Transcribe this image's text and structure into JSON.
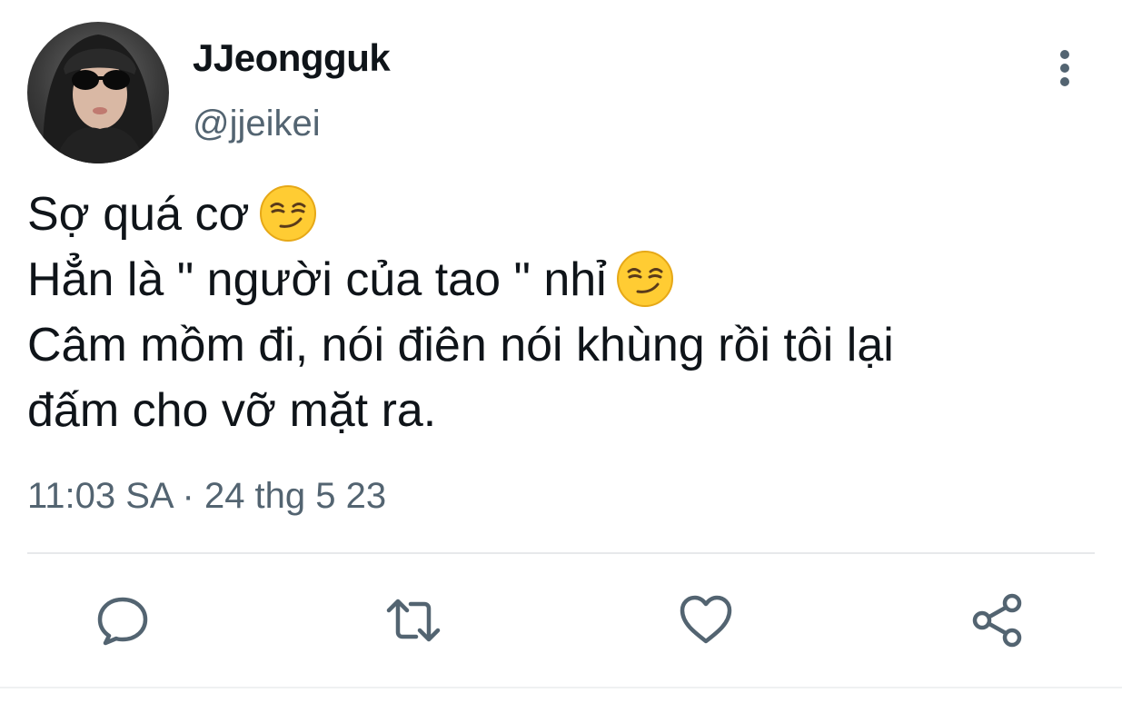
{
  "author": {
    "display_name": "JJeongguk",
    "handle": "@jjeikei",
    "avatar": "avatar-photo"
  },
  "tweet": {
    "lines": [
      "Sợ quá cơ",
      "Hẳn là \" người của tao \" nhỉ",
      "Câm mồm đi, nói điên nói khùng rồi tôi lại",
      "đấm cho vỡ mặt ra."
    ],
    "emoji": "smirking-face"
  },
  "timestamp": "11:03 SA · 24 thg 5 23",
  "icons": {
    "more": "more-vertical-icon",
    "reply": "reply-icon",
    "retweet": "retweet-icon",
    "like": "heart-icon",
    "share": "share-icon"
  },
  "colors": {
    "text_primary": "#0f1419",
    "text_secondary": "#536471",
    "divider": "#e7e9eb",
    "emoji_fill": "#ffcc33"
  }
}
